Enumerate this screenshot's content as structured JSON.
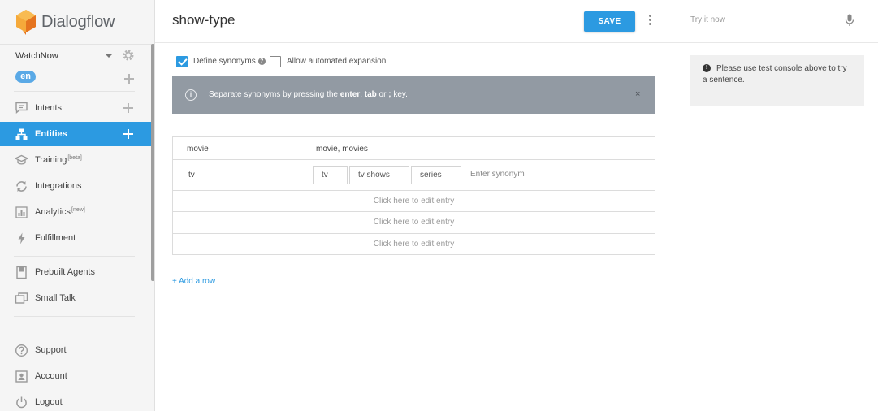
{
  "brand": {
    "name": "Dialogflow",
    "colors": {
      "orange": "#f29b2e",
      "orange_dark": "#e5741f",
      "accent": "#2c9ae1"
    }
  },
  "sidebar": {
    "agent_name": "WatchNow",
    "language": "en",
    "nav": [
      {
        "label": "Intents",
        "icon": "chat-icon",
        "has_plus": true
      },
      {
        "label": "Entities",
        "icon": "hierarchy-icon",
        "has_plus": true,
        "active": true
      },
      {
        "label": "Training",
        "icon": "graduation-cap-icon",
        "tag": "[beta]"
      },
      {
        "label": "Integrations",
        "icon": "sync-icon"
      },
      {
        "label": "Analytics",
        "icon": "bar-chart-icon",
        "tag": "[new]"
      },
      {
        "label": "Fulfillment",
        "icon": "lightning-icon"
      }
    ],
    "extras": [
      {
        "label": "Prebuilt Agents",
        "icon": "book-icon"
      },
      {
        "label": "Small Talk",
        "icon": "chat-bubbles-icon"
      }
    ],
    "footer": [
      {
        "label": "Support",
        "icon": "help-circle-icon"
      },
      {
        "label": "Account",
        "icon": "account-icon"
      },
      {
        "label": "Logout",
        "icon": "power-icon"
      }
    ]
  },
  "main": {
    "title": "show-type",
    "save_label": "SAVE",
    "options": {
      "define_synonyms": {
        "label": "Define synonyms",
        "checked": true
      },
      "automated_expansion": {
        "label": "Allow automated expansion",
        "checked": false
      }
    },
    "info": {
      "prefix": "Separate synonyms by pressing the ",
      "key1": "enter",
      "sep": ", ",
      "key2": "tab",
      "mid": " or ",
      "key3": ";",
      "suffix": " key.",
      "close": "×"
    },
    "entries": [
      {
        "reference": "movie",
        "synonyms_text": "movie, movies"
      },
      {
        "reference": "tv",
        "chips": [
          "tv",
          "tv shows",
          "series"
        ],
        "placeholder": "Enter synonym"
      }
    ],
    "empty_entry_text": "Click here to edit entry",
    "add_row": "+ Add a row"
  },
  "right": {
    "try_placeholder": "Try it now",
    "console_text": "Please use test console above to try a sentence."
  }
}
